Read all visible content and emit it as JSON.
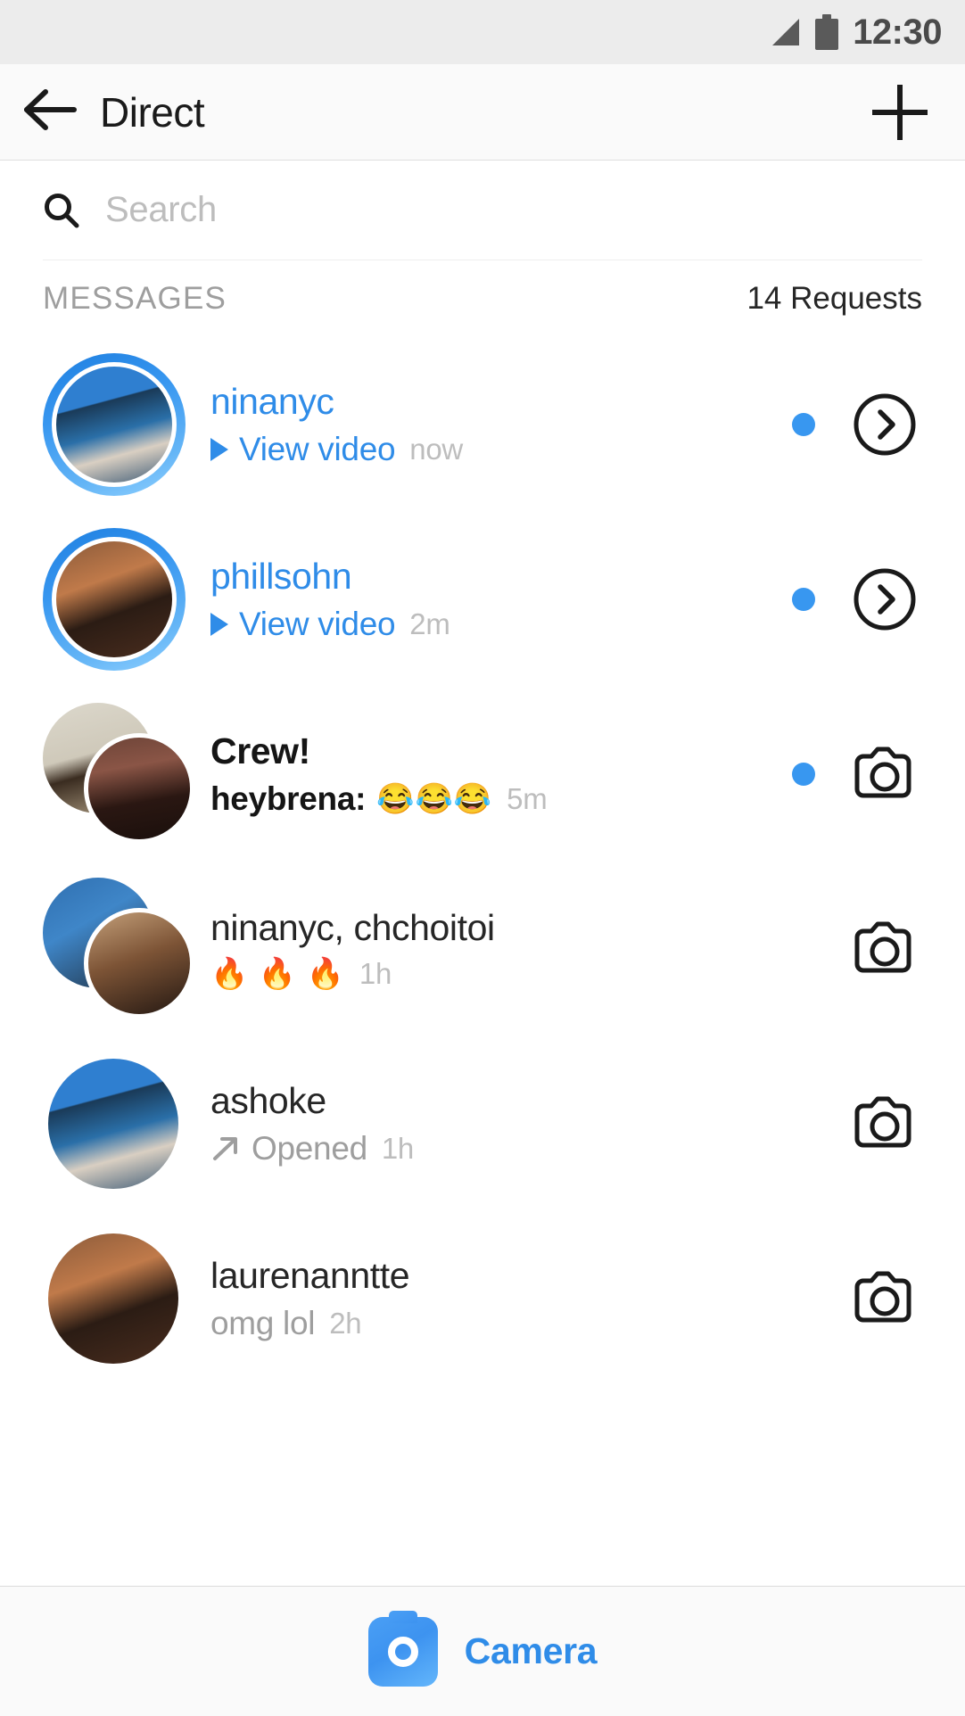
{
  "statusbar": {
    "time": "12:30",
    "signal_icon": "signal-bars-icon",
    "battery_icon": "battery-full-icon"
  },
  "appbar": {
    "back_icon": "back-arrow-icon",
    "title": "Direct",
    "new_message_icon": "plus-icon"
  },
  "search": {
    "icon": "search-icon",
    "placeholder": "Search",
    "value": ""
  },
  "section": {
    "title": "MESSAGES",
    "requests_label": "14 Requests"
  },
  "colors": {
    "accent_blue": "#3897f0",
    "link_blue": "#2f8ce8",
    "unread_dot": "#3897f0",
    "muted_gray": "#9e9e9e",
    "time_gray": "#bdbdbd",
    "text_dark": "#262626",
    "statusbar_bg": "#ececec",
    "appbar_bg": "#fafafa"
  },
  "threads": [
    {
      "name": "ninanyc",
      "name_style": "blue",
      "preview_prefix": "",
      "preview_prefix_style": "",
      "preview_icon": "play-triangle-icon",
      "preview": "View video",
      "preview_style": "blue",
      "emoji": "",
      "time": "now",
      "unread": true,
      "avatar": "story-ring-avatar",
      "action_icon": "chevron-right-circle-icon"
    },
    {
      "name": "phillsohn",
      "name_style": "blue",
      "preview_prefix": "",
      "preview_prefix_style": "",
      "preview_icon": "play-triangle-icon",
      "preview": "View video",
      "preview_style": "blue",
      "emoji": "",
      "time": "2m",
      "unread": true,
      "avatar": "story-ring-avatar",
      "action_icon": "chevron-right-circle-icon"
    },
    {
      "name": "Crew!",
      "name_style": "bold",
      "preview_prefix": "heybrena:",
      "preview_prefix_style": "boldblack",
      "preview_icon": "",
      "preview": "",
      "preview_style": "",
      "emoji": "😂😂😂",
      "time": "5m",
      "unread": true,
      "avatar": "stacked-group-avatar",
      "action_icon": "camera-outline-icon"
    },
    {
      "name": "ninanyc, chchoitoi",
      "name_style": "",
      "preview_prefix": "",
      "preview_prefix_style": "",
      "preview_icon": "",
      "preview": "",
      "preview_style": "",
      "emoji": "🔥 🔥 🔥",
      "time": "1h",
      "unread": false,
      "avatar": "stacked-group-avatar",
      "action_icon": "camera-outline-icon"
    },
    {
      "name": "ashoke",
      "name_style": "",
      "preview_prefix": "",
      "preview_prefix_style": "",
      "preview_icon": "opened-arrow-icon",
      "preview": "Opened",
      "preview_style": "",
      "emoji": "",
      "time": "1h",
      "unread": false,
      "avatar": "single-avatar",
      "action_icon": "camera-outline-icon"
    },
    {
      "name": "laurenanntte",
      "name_style": "",
      "preview_prefix": "",
      "preview_prefix_style": "",
      "preview_icon": "",
      "preview": "omg lol",
      "preview_style": "",
      "emoji": "",
      "time": "2h",
      "unread": false,
      "avatar": "single-avatar",
      "action_icon": "camera-outline-icon"
    }
  ],
  "camera_bar": {
    "icon": "camera-filled-icon",
    "label": "Camera"
  }
}
